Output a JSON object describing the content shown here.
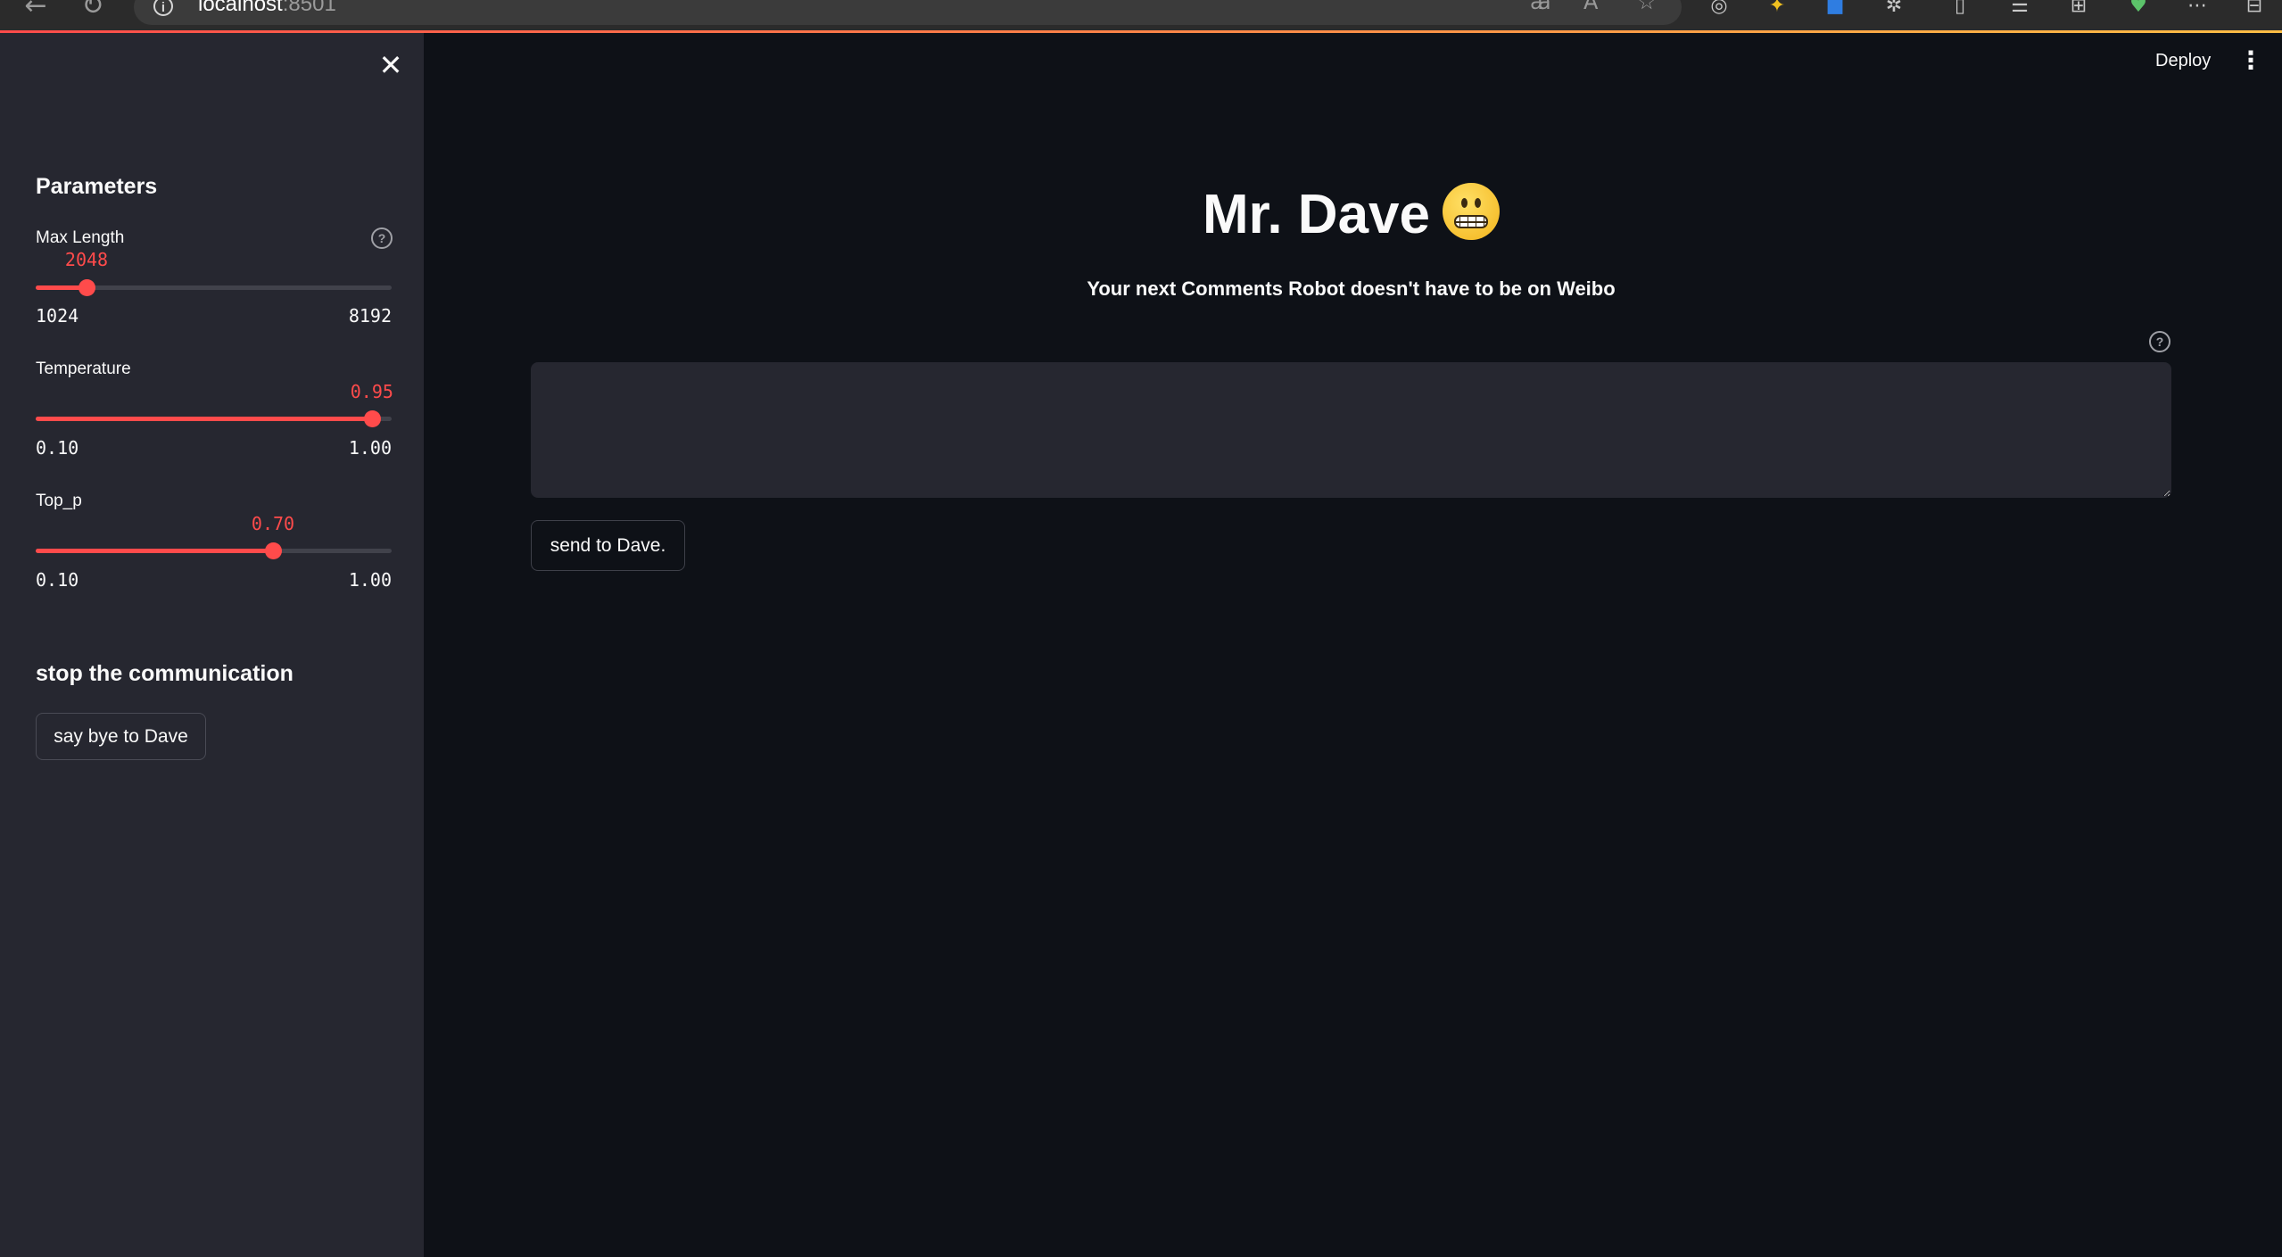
{
  "browser": {
    "url_host": "localhost",
    "url_port": ":8501",
    "back_icon": "←",
    "reload_icon": "↻",
    "extensions": [
      "read-aloud-icon",
      "reading-view-icon",
      "favorite-star-icon",
      "extension-icon",
      "extension-icon",
      "extension-icon",
      "extensions-puzzle-icon",
      "split-screen-icon",
      "favorites-icon",
      "collections-icon",
      "performance-icon",
      "more-icon",
      "sidebar-icon"
    ]
  },
  "sidebar": {
    "close_icon": "✕",
    "parameters_heading": "Parameters",
    "max_length": {
      "label": "Max Length",
      "value": "2048",
      "min": "1024",
      "max": "8192",
      "current": 2048,
      "range": [
        1024,
        8192
      ]
    },
    "temperature": {
      "label": "Temperature",
      "value": "0.95",
      "min": "0.10",
      "max": "1.00",
      "current": 0.95,
      "range": [
        0.1,
        1.0
      ]
    },
    "top_p": {
      "label": "Top_p",
      "value": "0.70",
      "min": "0.10",
      "max": "1.00",
      "current": 0.7,
      "range": [
        0.1,
        1.0
      ]
    },
    "help_icon": "?",
    "stop_heading": "stop the communication",
    "bye_button": "say bye to Dave"
  },
  "header": {
    "deploy": "Deploy",
    "menu_icon": "⋮"
  },
  "main": {
    "title": "Mr. Dave",
    "subtitle": "Your next Comments Robot doesn't have to be on Weibo",
    "input_value": "",
    "send_button": "send to Dave."
  },
  "colors": {
    "accent": "#ff4b4b",
    "background": "#0e1117",
    "sidebar": "#262730"
  }
}
